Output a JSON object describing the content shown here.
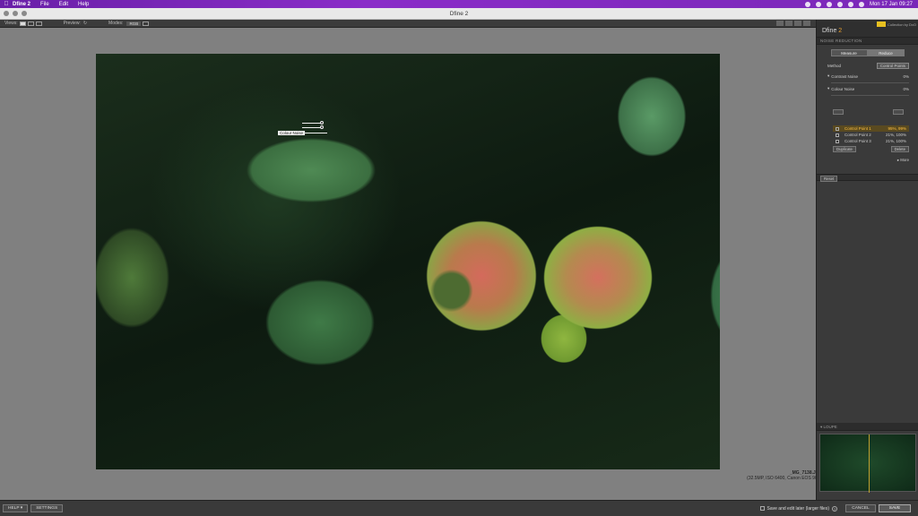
{
  "menubar": {
    "app": "Dfine 2",
    "items": [
      "File",
      "Edit",
      "Help"
    ],
    "clock": "Mon 17 Jan 09:27"
  },
  "window": {
    "title": "Dfine 2"
  },
  "toolbar": {
    "views_label": "Views:",
    "preview_label": "Preview:",
    "modes_label": "Modes:",
    "mode_value": "RGB"
  },
  "overlay": {
    "control_label": "Colour Noise"
  },
  "image_info": {
    "filename": "_MG_7138.JPG",
    "details": "(32.5MP, ISO 6400, Canon EOS 90D)"
  },
  "panel": {
    "product_name": "Dfine",
    "product_version": "2",
    "brand": "Collection by DxO",
    "section_title": "NOISE REDUCTION",
    "tabs": [
      "Measure",
      "Reduce"
    ],
    "method_label": "Method",
    "method_value": "Control Points",
    "contrast_noise_label": "Contrast Noise",
    "contrast_noise_value": "0%",
    "colour_noise_label": "Colour Noise",
    "colour_noise_value": "0%",
    "control_points": [
      {
        "label": "Control Point 1",
        "value": "95%, 99%"
      },
      {
        "label": "Control Point 2",
        "value": "21%, 100%"
      },
      {
        "label": "Control Point 3",
        "value": "21%, 100%"
      }
    ],
    "duplicate_label": "Duplicate",
    "delete_label": "Delete",
    "more_label": "More",
    "reset_label": "Reset",
    "loupe_label": "LOUPE"
  },
  "bottom": {
    "help_label": "HELP",
    "settings_label": "SETTINGS",
    "save_later_label": "Save and edit later (larger files)",
    "cancel_label": "CANCEL",
    "save_label": "SAVE"
  }
}
